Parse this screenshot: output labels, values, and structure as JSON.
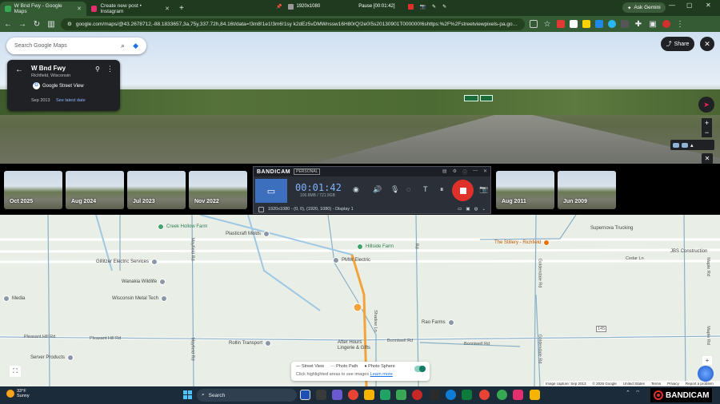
{
  "browser": {
    "tabs": [
      {
        "label": "W Bnd Fwy - Google Maps",
        "active": true,
        "color": "#34a853"
      },
      {
        "label": "Create new post • Instagram",
        "active": false,
        "color": "#e1306c"
      }
    ],
    "new_tab": "+",
    "recording_bar": {
      "resolution": "1920x1080",
      "status": "Pause [00:01:42]"
    },
    "ask_gemini": "Ask Gemini",
    "url": "google.com/maps/@43.2678712,-88.1833657,3a,75y,337.72h,84.16t/data=!3m8!1e1!3m6!1sy k2dEz5vDMWnssw16H80rQ!2e0!5s20130901T000000!6shttps:%2F%2Fstreetviewpixels-pa.googleapis.com..."
  },
  "search": {
    "placeholder": "Search Google Maps"
  },
  "info_card": {
    "title": "W Bnd Fwy",
    "subtitle": "Richfield, Wisconsin",
    "provider": "Google Street View",
    "date": "Sep 2013",
    "latest_link": "See latest date"
  },
  "share_label": "Share",
  "timeline": [
    {
      "label": "Oct 2025"
    },
    {
      "label": "Aug 2024"
    },
    {
      "label": "Jul 2023"
    },
    {
      "label": "Nov 2022"
    },
    {
      "label": "Aug 2011"
    },
    {
      "label": "Jun 2009"
    }
  ],
  "bandicam": {
    "logo": "BANDICAM",
    "edition": "PERSONAL",
    "time": "00:01:42",
    "size": "106.8MB / 721.9GB",
    "bottom": "1920x1080 - (0, 0), (1920, 1080) - Display 1"
  },
  "map": {
    "pois": [
      {
        "name": "Creek Hollow Farm",
        "type": "green"
      },
      {
        "name": "Plasticraft Molds",
        "type": "gray"
      },
      {
        "name": "Hillside Farm",
        "type": "green"
      },
      {
        "name": "The Stillery - Richfield",
        "type": "orange"
      },
      {
        "name": "Supernova Trucking",
        "type": "gray"
      },
      {
        "name": "Gillitzer Electric Services",
        "type": "gray"
      },
      {
        "name": "PMW Electric",
        "type": "gray"
      },
      {
        "name": "JBS Construction",
        "type": "gray"
      },
      {
        "name": "Wanakia Wildlife",
        "type": "gray"
      },
      {
        "name": "Wisconsin Metal Tech",
        "type": "gray"
      },
      {
        "name": "Rao Farms",
        "type": "gray"
      },
      {
        "name": "Rollin Transport",
        "type": "gray"
      },
      {
        "name": "After Hours Lingerie & Gifts",
        "type": "gray"
      },
      {
        "name": "Server Products",
        "type": "gray"
      },
      {
        "name": "Media",
        "type": "gray"
      }
    ],
    "roads": [
      "Pleasant Hill Rd",
      "Pleasant Hill Rd",
      "Bonniwell Rd",
      "Bonniwell Rd",
      "Cedar Ln",
      "Maple Rd",
      "Maple Rd",
      "Mayfield Rd",
      "Mayfield Rd",
      "Goldendale Rd",
      "Goldendale Rd",
      "Shadow Ln",
      "Rd"
    ],
    "highway": "145"
  },
  "legend": {
    "street_view": "Street View",
    "photo_path": "Photo Path",
    "photo_sphere": "Photo Sphere",
    "hint": "Click highlighted areas to see images",
    "learn_more": "Learn more"
  },
  "map_footer": [
    "Image capture: Sep 2013",
    "© 2026 Google",
    "United States",
    "Terms",
    "Privacy",
    "Report a problem"
  ],
  "taskbar": {
    "temp": "33°F",
    "weather": "Sunny",
    "search": "Search",
    "watermark": "BANDICAM"
  }
}
